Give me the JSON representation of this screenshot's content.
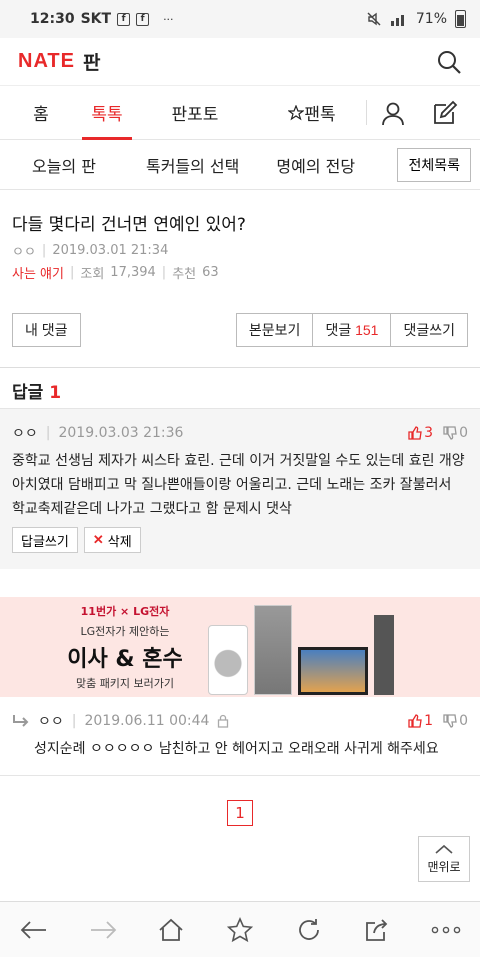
{
  "status_bar": {
    "time": "12:30",
    "carrier": "SKT",
    "battery": "71%"
  },
  "header": {
    "logo": "NATE",
    "section": "판"
  },
  "nav": {
    "items": [
      "홈",
      "톡톡",
      "판포토",
      "팬톡"
    ]
  },
  "subnav": {
    "items": [
      "오늘의 판",
      "톡커들의 선택",
      "명예의 전당"
    ],
    "all_button": "전체목록"
  },
  "article": {
    "title": "다들 몇다리 건너면 연예인 있어?",
    "author": "ㅇㅇ",
    "date": "2019.03.01 21:34",
    "category": "사는 얘기",
    "views_label": "조회",
    "views": "17,394",
    "recommend_label": "추천",
    "recommend": "63"
  },
  "buttons": {
    "my_comments": "내 댓글",
    "view_body": "본문보기",
    "comments_label": "댓글",
    "comments_count": "151",
    "write_comment": "댓글쓰기"
  },
  "replies": {
    "title": "답글",
    "count": "1"
  },
  "comment": {
    "author": "ㅇㅇ",
    "date": "2019.03.03 21:36",
    "up": "3",
    "down": "0",
    "body": "중학교 선생님 제자가 씨스타 효린. 근데 이거 거짓말일 수도 있는데 효린 개양아치였대 담배피고 막 질나쁜애들이랑 어울리고. 근데 노래는 조카 잘불러서 학교축제같은데 나가고 그랬다고 함 문제시 댓삭",
    "reply_button": "답글쓰기",
    "delete_button": "삭제"
  },
  "ad": {
    "brand": "11번가 × LG전자",
    "line1": "LG전자가 제안하는",
    "line2": "이사 & 혼수",
    "line3": "맞춤 패키지 보러가기"
  },
  "reply": {
    "author": "ㅇㅇ",
    "date": "2019.06.11 00:44",
    "up": "1",
    "down": "0",
    "body": "성지순례 ㅇㅇㅇㅇㅇ 남친하고 안 헤어지고 오래오래 사귀게 해주세요"
  },
  "pagination": {
    "current": "1"
  },
  "top_button": "맨위로"
}
